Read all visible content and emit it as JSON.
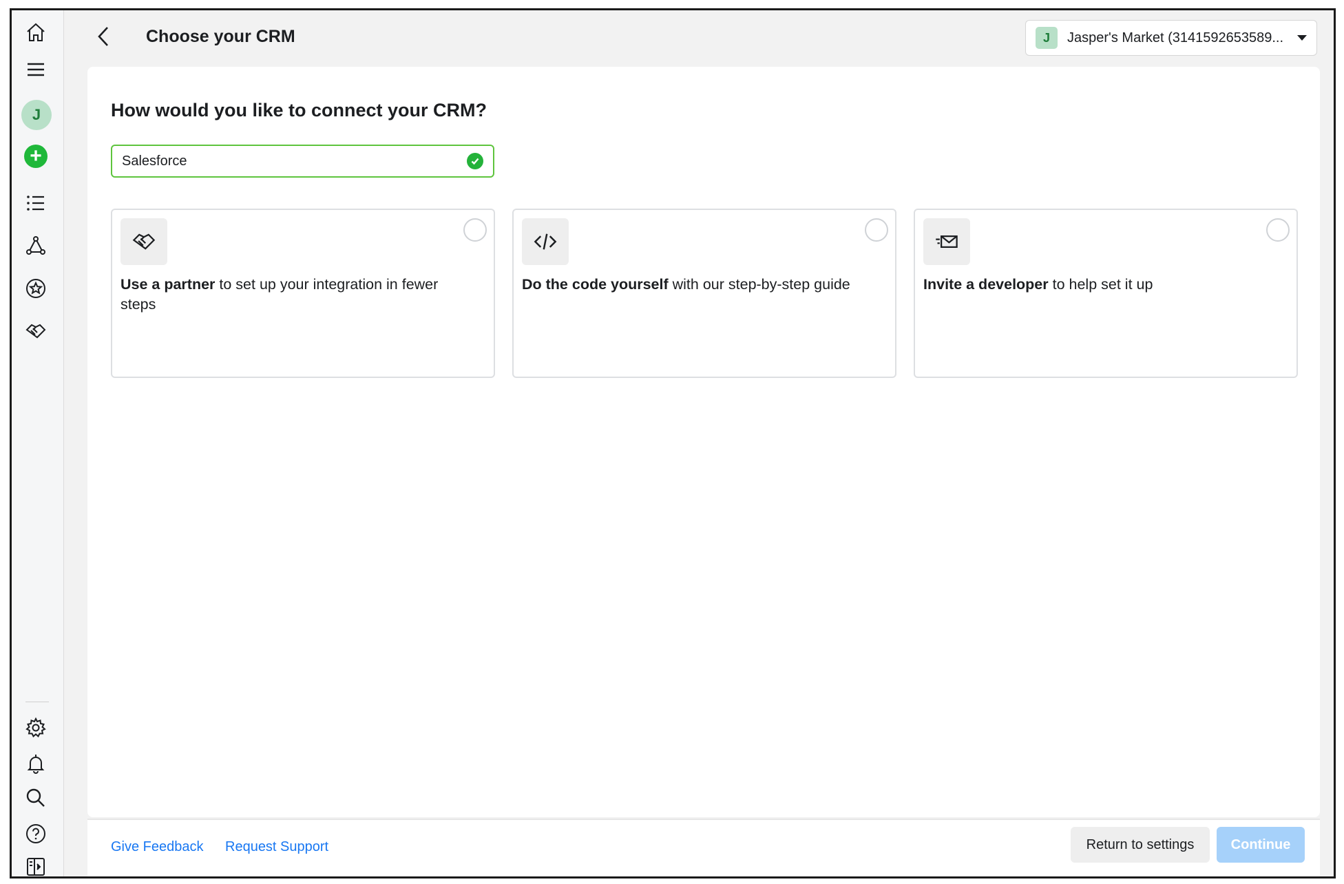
{
  "header": {
    "title": "Choose your CRM",
    "account": {
      "initial": "J",
      "name": "Jasper's Market (3141592653589..."
    }
  },
  "sidebar": {
    "avatar_initial": "J",
    "icons": [
      "home-icon",
      "menu-icon",
      "avatar",
      "create-icon",
      "list-icon",
      "graph-icon",
      "star-icon",
      "handshake-icon",
      "gear-icon",
      "bell-icon",
      "search-icon",
      "help-icon",
      "sidebar-toggle-icon"
    ]
  },
  "main": {
    "question": "How would you like to connect your CRM?",
    "crm_input_value": "Salesforce",
    "options": [
      {
        "icon": "handshake-icon",
        "bold": "Use a partner",
        "rest": " to set up your integration in fewer steps"
      },
      {
        "icon": "code-icon",
        "bold": "Do the code yourself",
        "rest": " with our step-by-step guide"
      },
      {
        "icon": "envelope-icon",
        "bold": "Invite a developer",
        "rest": " to help set it up"
      }
    ]
  },
  "footer": {
    "give_feedback": "Give Feedback",
    "request_support": "Request Support",
    "return_label": "Return to settings",
    "continue_label": "Continue"
  },
  "colors": {
    "accent_green": "#24b23a",
    "link_blue": "#1877f2",
    "disabled_blue": "#a6d1fa"
  }
}
